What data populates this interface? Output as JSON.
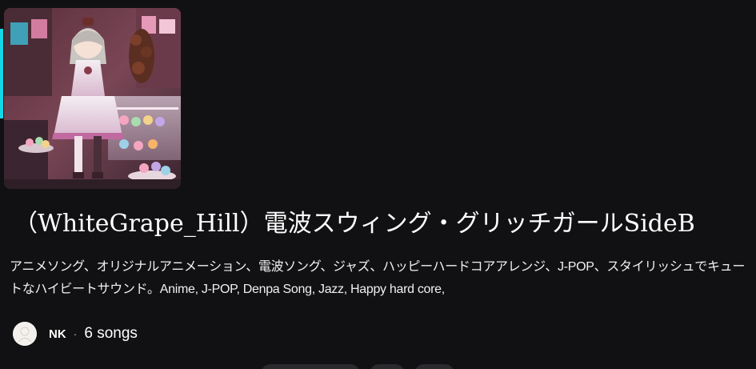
{
  "playlist": {
    "title": "（WhiteGrape_Hill）電波スウィング・グリッチガールSideB",
    "description": "アニメソング、オリジナルアニメーション、電波ソング、ジャズ、ハッピーハードコアアレンジ、J-POP、スタイリッシュでキュートなハイビートサウンド。Anime, J-POP, Denpa Song, Jazz, Happy hard core,",
    "owner": "NK",
    "separator": "·",
    "song_count": "6 songs"
  },
  "colors": {
    "background": "#111113",
    "accent_edge": "#12d8e6",
    "text": "#ffffff",
    "pill": "#2a2a2e"
  },
  "icons": {
    "cover": "anime-girl-cafe-cover-art",
    "avatar": "user-avatar"
  }
}
